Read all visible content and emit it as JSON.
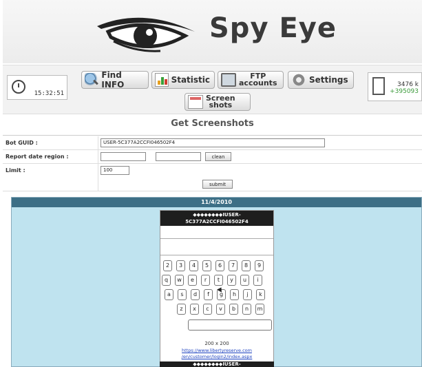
{
  "header": {
    "brand": "Spy Eye"
  },
  "status": {
    "time": "15:32:51",
    "counter_total": "3476 k",
    "counter_delta": "+395093"
  },
  "toolbar": {
    "find_info": "Find INFO",
    "statistic": "Statistic",
    "ftp_line1": "FTP",
    "ftp_line2": "accounts",
    "settings": "Settings",
    "shots_line1": "Screen",
    "shots_line2": "shots"
  },
  "page": {
    "title": "Get Screenshots"
  },
  "form": {
    "bot_guid_label": "Bot GUID :",
    "bot_guid_value": "USER-5C377A2CCFI046502F4",
    "report_date_label": "Report date region :",
    "clean_label": "clean",
    "limit_label": "Limit :",
    "limit_value": "100",
    "submit_label": "submit"
  },
  "results": {
    "date": "11/4/2010",
    "shot_title_line1": "◆◆◆◆◆◆◆◆IUSER-",
    "shot_title_line2": "5C377A2CCFI046502F4",
    "keyboard_rows": [
      [
        "2",
        "3",
        "4",
        "5",
        "6",
        "7",
        "8",
        "9"
      ],
      [
        "q",
        "w",
        "e",
        "r",
        "t",
        "y",
        "u",
        "i"
      ],
      [
        "a",
        "s",
        "d",
        "f",
        "g",
        "h",
        "j",
        "k"
      ],
      [
        "z",
        "x",
        "c",
        "v",
        "b",
        "n",
        "m"
      ]
    ],
    "shot_size": "200 x 200",
    "shot_url_line1": "https://www.libertyreserve.com",
    "shot_url_line2": "/en/customer/login2/index.aspx",
    "next_shot_title": "◆◆◆◆◆◆◆◆IUSER-"
  },
  "icons": {
    "clock": "clock-icon",
    "find": "magnifier-icon",
    "stat": "bar-chart-icon",
    "ftp": "monitor-icon",
    "settings": "gear-icon",
    "shots": "screenshot-icon",
    "counter": "document-icon"
  }
}
